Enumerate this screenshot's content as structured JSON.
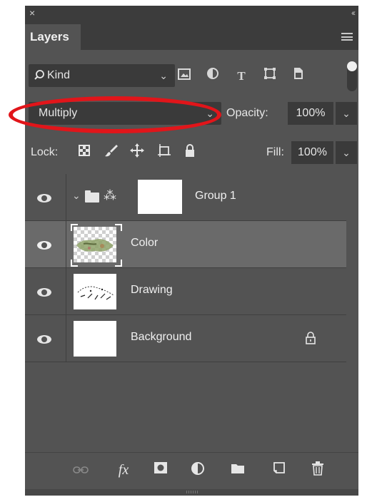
{
  "panel": {
    "close_glyph": "×",
    "collapse_glyph": "‹‹",
    "tab_title": "Layers",
    "menu_icon": "hamburger-menu-icon"
  },
  "filter": {
    "kind_label": "Kind",
    "search_icon": "magnifier-icon",
    "icons": [
      "image-filter-icon",
      "adjustment-filter-icon",
      "type-filter-icon",
      "shape-filter-icon",
      "smart-object-filter-icon"
    ],
    "type_glyph": "T"
  },
  "blend": {
    "mode": "Multiply",
    "opacity_label": "Opacity:",
    "opacity_value": "100%"
  },
  "lock": {
    "label": "Lock:",
    "fill_label": "Fill:",
    "fill_value": "100%"
  },
  "layers": [
    {
      "name": "Group 1",
      "type": "group",
      "selected": false
    },
    {
      "name": "Color",
      "type": "pixel",
      "selected": true
    },
    {
      "name": "Drawing",
      "type": "pixel",
      "selected": false
    },
    {
      "name": "Background",
      "type": "background",
      "selected": false,
      "locked": true
    }
  ],
  "footer": {
    "icons": [
      "link-layers-icon",
      "fx-icon",
      "add-mask-icon",
      "new-adjustment-icon",
      "new-group-icon",
      "new-layer-icon",
      "delete-layer-icon"
    ],
    "fx_label": "fx"
  },
  "colors": {
    "panel_bg": "#535353",
    "selected_row": "#6a6a6a",
    "annotation_red": "#e1151a"
  }
}
